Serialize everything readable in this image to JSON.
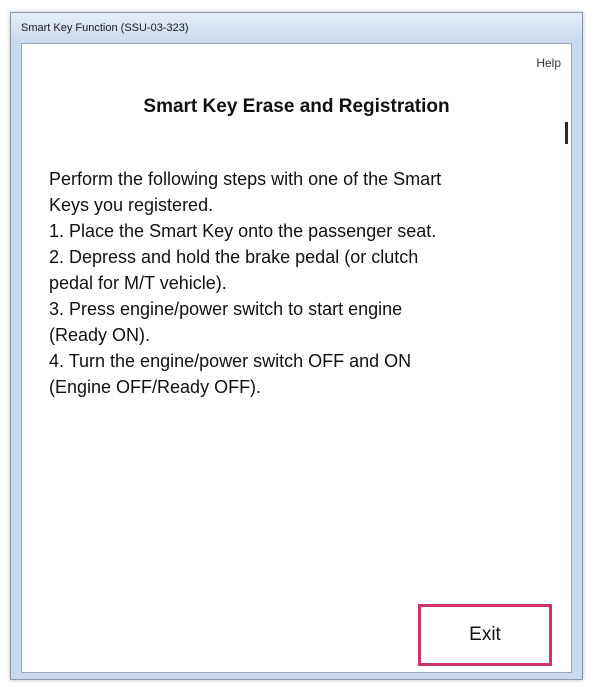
{
  "window": {
    "title": "Smart Key Function (SSU-03-323)"
  },
  "toolbar": {
    "help_label": "Help"
  },
  "content": {
    "heading": "Smart Key Erase and Registration",
    "lines": [
      "Perform the following steps with one of the Smart",
      "Keys you registered.",
      "1. Place the Smart Key onto the passenger seat.",
      "2. Depress and hold the brake pedal (or clutch",
      "pedal for M/T vehicle).",
      "3. Press engine/power switch to start engine",
      "(Ready ON).",
      "4. Turn the engine/power switch OFF and ON",
      "(Engine OFF/Ready OFF)."
    ]
  },
  "buttons": {
    "exit_label": "Exit"
  },
  "colors": {
    "exit_border": "#d0326e",
    "titlebar": "#c9d9ee"
  }
}
